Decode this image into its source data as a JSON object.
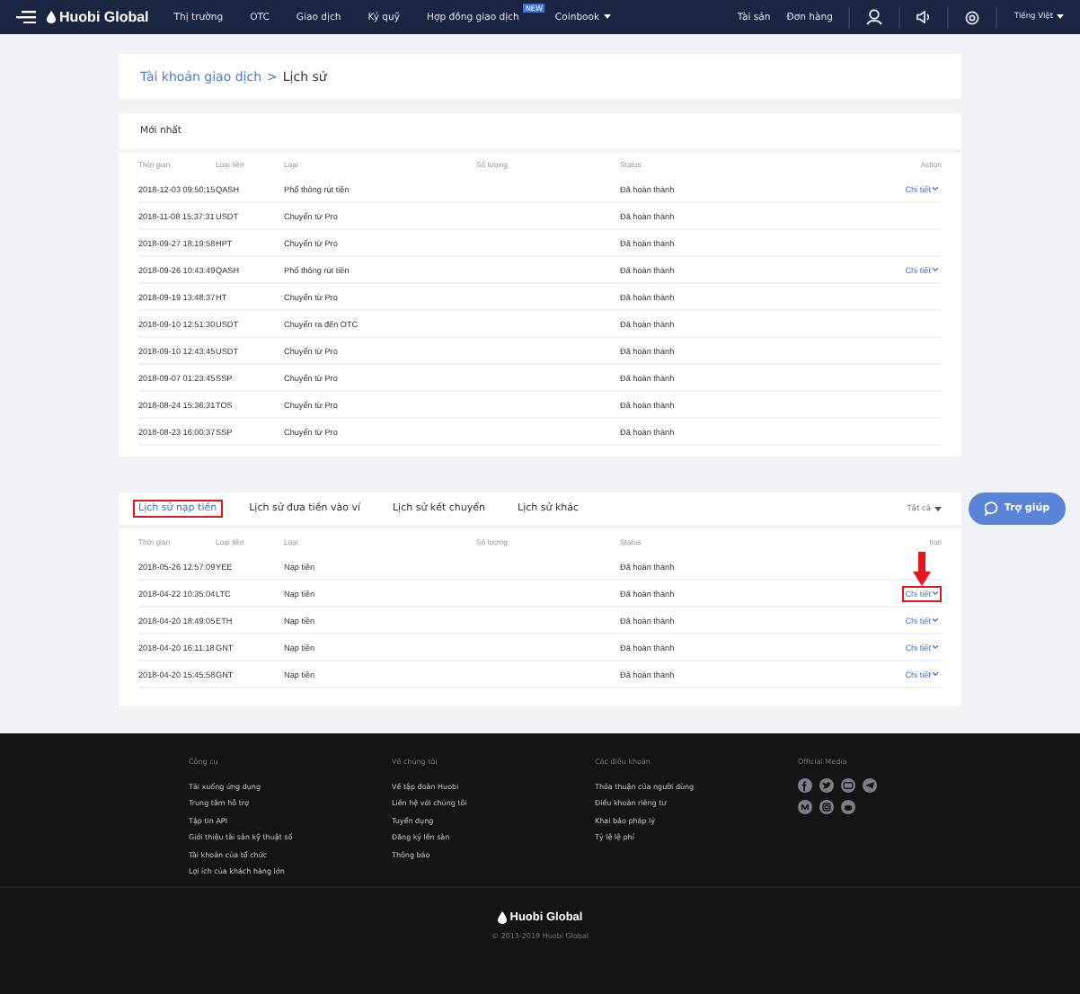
{
  "nav": {
    "logo": "Huobi Global",
    "items": [
      {
        "label": "Thị trường"
      },
      {
        "label": "OTC"
      },
      {
        "label": "Giao dịch"
      },
      {
        "label": "Ký quỹ"
      },
      {
        "label": "Hợp đồng giao dịch",
        "badge": "NEW"
      },
      {
        "label": "Coinbook",
        "dropdown": true
      }
    ],
    "right_items": [
      "Tài sản",
      "Đơn hàng"
    ],
    "language": "Tiếng Việt"
  },
  "breadcrumb": {
    "parent": "Tài khoản giao dịch",
    "separator": ">",
    "current": "Lịch sử"
  },
  "latest": {
    "title": "Mới nhất",
    "columns": [
      "Thời gian",
      "Loại tiền",
      "Loại",
      "Số lượng",
      "Status",
      "Action"
    ],
    "rows": [
      {
        "time": "2018-12-03 09:50:15",
        "currency": "QASH",
        "type": "Phổ thông rút tiền",
        "status": "Đã hoàn thành",
        "action": "Chi tiết"
      },
      {
        "time": "2018-11-08 15:37:31",
        "currency": "USDT",
        "type": "Chuyển từ Pro",
        "status": "Đã hoàn thành"
      },
      {
        "time": "2018-09-27 18:19:58",
        "currency": "HPT",
        "type": "Chuyển từ Pro",
        "status": "Đã hoàn thành"
      },
      {
        "time": "2018-09-26 10:43:49",
        "currency": "QASH",
        "type": "Phổ thông rút tiền",
        "status": "Đã hoàn thành",
        "action": "Chi tiết"
      },
      {
        "time": "2018-09-19 13:48:37",
        "currency": "HT",
        "type": "Chuyển từ Pro",
        "status": "Đã hoàn thành"
      },
      {
        "time": "2018-09-10 12:51:30",
        "currency": "USDT",
        "type": "Chuyển ra đến OTC",
        "status": "Đã hoàn thành"
      },
      {
        "time": "2018-09-10 12:43:45",
        "currency": "USDT",
        "type": "Chuyển từ Pro",
        "status": "Đã hoàn thành"
      },
      {
        "time": "2018-09-07 01:23:45",
        "currency": "SSP",
        "type": "Chuyển từ Pro",
        "status": "Đã hoàn thành"
      },
      {
        "time": "2018-08-24 15:36:31",
        "currency": "TOS",
        "type": "Chuyển từ Pro",
        "status": "Đã hoàn thành"
      },
      {
        "time": "2018-08-23 16:00:37",
        "currency": "SSP",
        "type": "Chuyển từ Pro",
        "status": "Đã hoàn thành"
      }
    ]
  },
  "history": {
    "tabs": [
      {
        "label": "Lịch sử nạp tiền",
        "selected": true,
        "highlighted": true
      },
      {
        "label": "Lịch sử đưa tiền vào ví",
        "selected": false,
        "highlighted": false
      },
      {
        "label": "Lịch sử kết chuyển",
        "selected": false,
        "highlighted": false
      },
      {
        "label": "Lịch sử khác",
        "selected": false,
        "highlighted": false
      }
    ],
    "filter": "Tất cả",
    "columns": [
      "Thời gian",
      "Loại tiền",
      "Loại",
      "Số lượng",
      "Status",
      "tion"
    ],
    "rows": [
      {
        "time": "2018-05-26 12:57:09",
        "currency": "YEE",
        "type": "Nạp tiền",
        "status": "Đã hoàn thành"
      },
      {
        "time": "2018-04-22 10:35:04",
        "currency": "LTC",
        "type": "Nạp tiền",
        "status": "Đã hoàn thành",
        "action": "Chi tiết",
        "highlighted": true
      },
      {
        "time": "2018-04-20 18:49:05",
        "currency": "ETH",
        "type": "Nạp tiền",
        "status": "Đã hoàn thành",
        "action": "Chi tiết",
        "highlighted": false
      },
      {
        "time": "2018-04-20 16:11:18",
        "currency": "GNT",
        "type": "Nạp tiền",
        "status": "Đã hoàn thành",
        "action": "Chi tiết",
        "highlighted": false
      },
      {
        "time": "2018-04-20 15:45:58",
        "currency": "GNT",
        "type": "Nạp tiền",
        "status": "Đã hoàn thành",
        "action": "Chi tiết",
        "highlighted": false
      }
    ]
  },
  "help_button": "Trợ giúp",
  "footer": {
    "columns": [
      {
        "title": "Công cụ",
        "links": [
          "Tải xuống ứng dụng",
          "Trung tâm hỗ trợ",
          "Tập tin API",
          "Giới thiệu tài sản kỹ thuật số",
          "Tài khoản của tổ chức",
          "Lợi ích của khách hàng lớn"
        ]
      },
      {
        "title": "Về chúng tôi",
        "links": [
          "Về tập đoàn Huobi",
          "Liên hệ với chúng tôi",
          "Tuyển dụng",
          "Đăng ký lên sàn",
          "Thông báo"
        ]
      },
      {
        "title": "Các điều khoản",
        "links": [
          "Thỏa thuận của người dùng",
          "Điều khoản riêng tư",
          "Khai báo pháp lý",
          "Tỷ lệ lệ phí"
        ]
      },
      {
        "title": "Official Media"
      }
    ],
    "logo": "Huobi Global",
    "copyright": "© 2013-2019 Huobi Global"
  }
}
